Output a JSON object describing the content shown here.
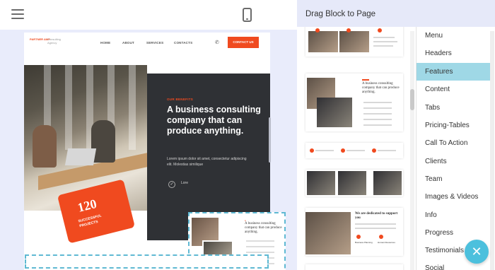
{
  "editor": {
    "panel_title": "Drag Block to Page",
    "categories": [
      {
        "label": "Menu"
      },
      {
        "label": "Headers"
      },
      {
        "label": "Features"
      },
      {
        "label": "Content"
      },
      {
        "label": "Tabs"
      },
      {
        "label": "Pricing-Tables"
      },
      {
        "label": "Call To Action"
      },
      {
        "label": "Clients"
      },
      {
        "label": "Team"
      },
      {
        "label": "Images & Videos"
      },
      {
        "label": "Info"
      },
      {
        "label": "Progress"
      },
      {
        "label": "Testimonials"
      },
      {
        "label": "Social"
      }
    ],
    "active_category": "Features",
    "icons": {
      "menu": "hamburger-icon",
      "device": "mobile-phone-icon",
      "close": "close-icon"
    },
    "colors": {
      "accent": "#4cc0dd",
      "active_category_bg": "#9fd8e6",
      "panel_header_bg": "#e6e9f9",
      "brand_orange": "#f04a1f"
    }
  },
  "preview": {
    "logo_text": "PARTNER AMP",
    "logo_sub": "Consulting Agency",
    "nav": [
      "HOME",
      "ABOUT",
      "SERVICES",
      "CONTACTS"
    ],
    "contact_button": "CONTACT US",
    "eyebrow": "OUR BENEFITS",
    "hero_title": "A business consulting company that can produce anything.",
    "hero_text": "Lorem ipsum dolor sit amet, consectetur adipiscing elit. Molestias similique",
    "bullet_peek": "Lore",
    "stat_number": "120",
    "stat_label": "SUCCESSFUL PROJECTS",
    "drop_preview_title": "A business consulting company that can produce anything."
  },
  "blocks": {
    "block2_title": "A business consulting company that can produce anything.",
    "block5_title": "We are dedicated to support you",
    "block5_item1": "Business Planning",
    "block5_item2": "Human Resources"
  }
}
